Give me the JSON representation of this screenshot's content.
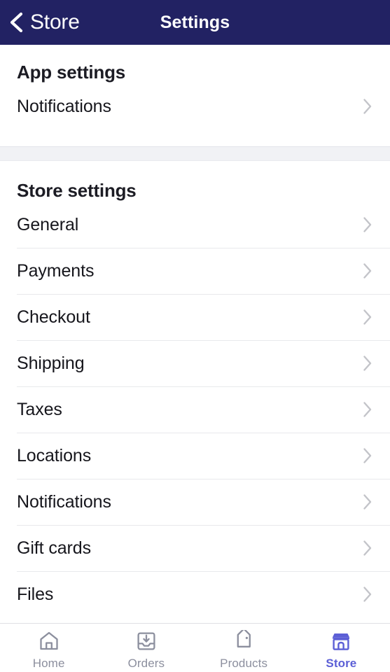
{
  "navbar": {
    "back_label": "Store",
    "back_icon": "chevron-left-icon",
    "title": "Settings",
    "background_color": "#222263",
    "text_color": "#ffffff"
  },
  "sections": [
    {
      "header": "App settings",
      "items": [
        {
          "label": "Notifications",
          "accessory_icon": "chevron-right-icon"
        }
      ]
    },
    {
      "header": "Store settings",
      "items": [
        {
          "label": "General",
          "accessory_icon": "chevron-right-icon"
        },
        {
          "label": "Payments",
          "accessory_icon": "chevron-right-icon"
        },
        {
          "label": "Checkout",
          "accessory_icon": "chevron-right-icon"
        },
        {
          "label": "Shipping",
          "accessory_icon": "chevron-right-icon"
        },
        {
          "label": "Taxes",
          "accessory_icon": "chevron-right-icon"
        },
        {
          "label": "Locations",
          "accessory_icon": "chevron-right-icon"
        },
        {
          "label": "Notifications",
          "accessory_icon": "chevron-right-icon"
        },
        {
          "label": "Gift cards",
          "accessory_icon": "chevron-right-icon"
        },
        {
          "label": "Files",
          "accessory_icon": "chevron-right-icon"
        }
      ]
    }
  ],
  "tabbar": {
    "active_color": "#5c5fd6",
    "inactive_color": "#8c8f9e",
    "tabs": [
      {
        "label": "Home",
        "icon": "home-icon",
        "active": false
      },
      {
        "label": "Orders",
        "icon": "orders-inbox-icon",
        "active": false
      },
      {
        "label": "Products",
        "icon": "product-tag-icon",
        "active": false
      },
      {
        "label": "Store",
        "icon": "storefront-icon",
        "active": true
      }
    ]
  }
}
